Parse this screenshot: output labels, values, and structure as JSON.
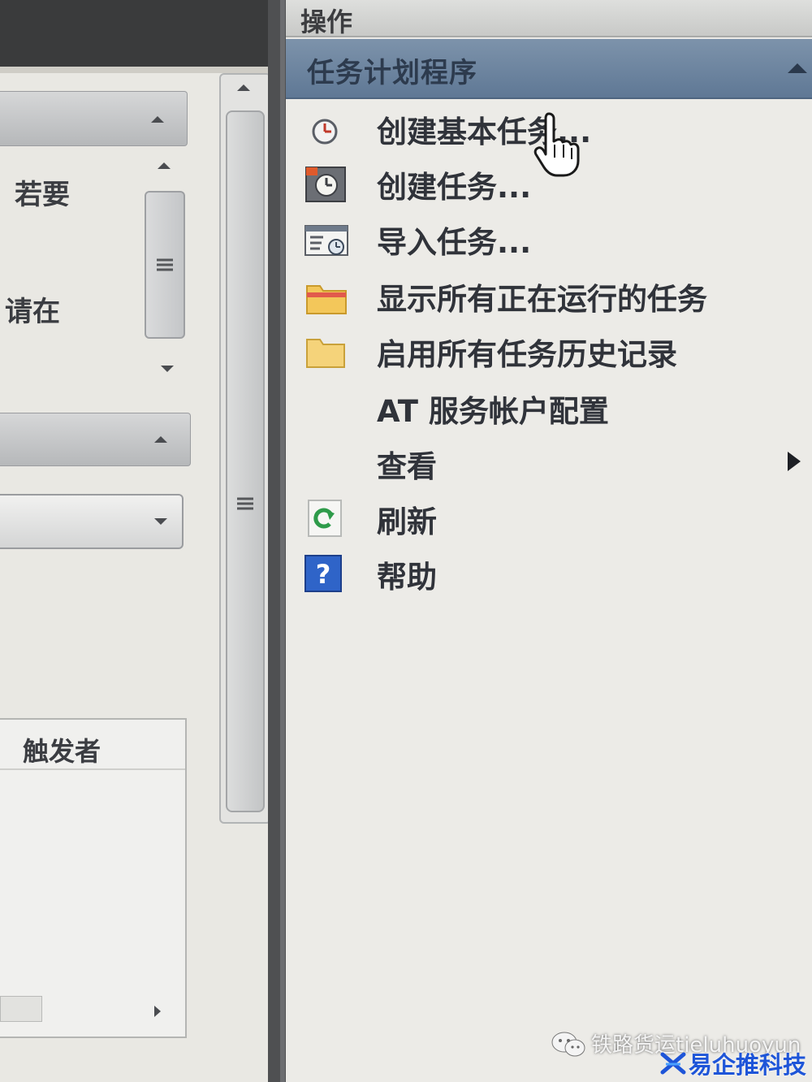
{
  "left_pane": {
    "text_ruoyao": "若要",
    "text_qingzai": "请在",
    "trigger_header": "触发者"
  },
  "actions_pane": {
    "title": "操作",
    "group": "任务计划程序",
    "items": [
      {
        "label": "创建基本任务...",
        "icon": "clock-icon"
      },
      {
        "label": "创建任务...",
        "icon": "task-clock-icon"
      },
      {
        "label": "导入任务...",
        "icon": "import-task-icon"
      },
      {
        "label": "显示所有正在运行的任务",
        "icon": "folder-icon"
      },
      {
        "label": "启用所有任务历史记录",
        "icon": "folder-icon"
      },
      {
        "label": "AT 服务帐户配置",
        "icon": ""
      },
      {
        "label": "查看",
        "icon": "",
        "submenu": true
      },
      {
        "label": "刷新",
        "icon": "refresh-icon"
      },
      {
        "label": "帮助",
        "icon": "help-icon"
      }
    ]
  },
  "watermark": {
    "line1": "铁路货运tieluhuoyun",
    "line2": "易企推科技"
  },
  "colors": {
    "group_header": "#6b83a0",
    "divider": "#4f5052",
    "help_blue": "#2f64c8"
  }
}
